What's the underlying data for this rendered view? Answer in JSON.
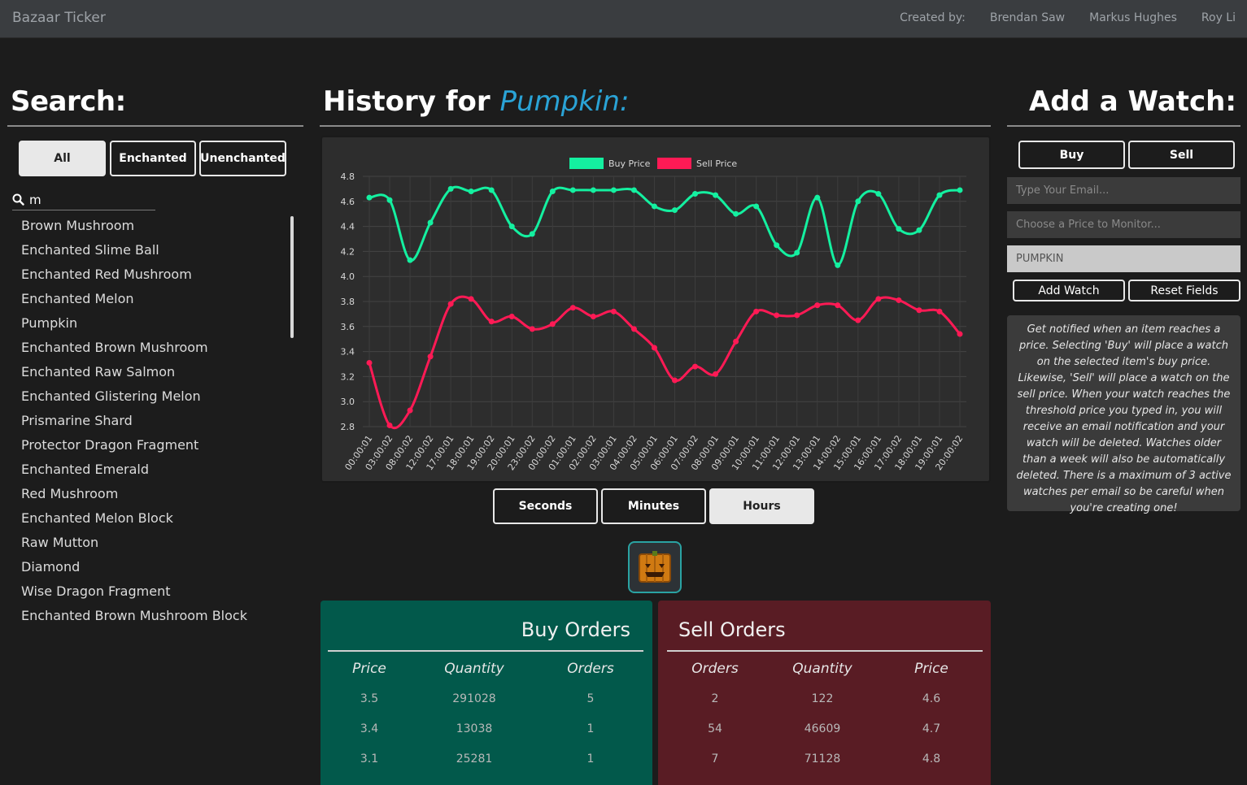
{
  "navbar": {
    "brand": "Bazaar Ticker",
    "created_by": "Created by:",
    "authors": [
      "Brendan Saw",
      "Markus Hughes",
      "Roy Li"
    ]
  },
  "search": {
    "title": "Search:",
    "filters": [
      "All",
      "Enchanted",
      "Unenchanted"
    ],
    "active_filter": "All",
    "query": "m",
    "items": [
      "Brown Mushroom",
      "Enchanted Slime Ball",
      "Enchanted Red Mushroom",
      "Enchanted Melon",
      "Pumpkin",
      "Enchanted Brown Mushroom",
      "Enchanted Raw Salmon",
      "Enchanted Glistering Melon",
      "Prismarine Shard",
      "Protector Dragon Fragment",
      "Enchanted Emerald",
      "Red Mushroom",
      "Enchanted Melon Block",
      "Raw Mutton",
      "Diamond",
      "Wise Dragon Fragment",
      "Enchanted Brown Mushroom Block"
    ]
  },
  "history": {
    "title_prefix": "History for",
    "item_name": "Pumpkin:",
    "time_buttons": [
      "Seconds",
      "Minutes",
      "Hours"
    ],
    "active_time": "Hours"
  },
  "chart_data": {
    "type": "line",
    "x": [
      "00:00:01",
      "03:00:02",
      "08:00:02",
      "12:00:02",
      "17:00:01",
      "18:00:01",
      "19:00:02",
      "20:00:01",
      "23:00:02",
      "00:00:02",
      "01:00:01",
      "02:00:02",
      "03:00:01",
      "04:00:02",
      "05:00:01",
      "06:00:01",
      "07:00:02",
      "08:00:01",
      "09:00:01",
      "10:00:01",
      "11:00:01",
      "12:00:01",
      "13:00:01",
      "14:00:02",
      "15:00:01",
      "16:00:01",
      "17:00:02",
      "18:00:01",
      "19:00:01",
      "20:00:02"
    ],
    "series": [
      {
        "name": "Buy Price",
        "color": "#14f0a0",
        "values": [
          4.63,
          4.61,
          4.13,
          4.43,
          4.7,
          4.68,
          4.69,
          4.4,
          4.34,
          4.68,
          4.69,
          4.69,
          4.69,
          4.69,
          4.56,
          4.53,
          4.66,
          4.65,
          4.5,
          4.56,
          4.25,
          4.19,
          4.63,
          4.09,
          4.6,
          4.66,
          4.38,
          4.37,
          4.65,
          4.69
        ]
      },
      {
        "name": "Sell Price",
        "color": "#ff1a55",
        "values": [
          3.31,
          2.81,
          2.93,
          3.36,
          3.78,
          3.82,
          3.64,
          3.68,
          3.58,
          3.62,
          3.75,
          3.68,
          3.72,
          3.58,
          3.43,
          3.17,
          3.28,
          3.22,
          3.48,
          3.72,
          3.69,
          3.69,
          3.77,
          3.77,
          3.65,
          3.82,
          3.81,
          3.73,
          3.72,
          3.54
        ]
      }
    ],
    "ylim": [
      2.8,
      4.8
    ],
    "yticks": [
      2.8,
      3.0,
      3.2,
      3.4,
      3.6,
      3.8,
      4.0,
      4.2,
      4.4,
      4.6,
      4.8
    ],
    "legend": "top-center",
    "grid": true
  },
  "buy_orders": {
    "title": "Buy Orders",
    "headers": [
      "Price",
      "Quantity",
      "Orders"
    ],
    "rows": [
      [
        "3.5",
        "291028",
        "5"
      ],
      [
        "3.4",
        "13038",
        "1"
      ],
      [
        "3.1",
        "25281",
        "1"
      ]
    ]
  },
  "sell_orders": {
    "title": "Sell Orders",
    "headers": [
      "Orders",
      "Quantity",
      "Price"
    ],
    "rows": [
      [
        "2",
        "122",
        "4.6"
      ],
      [
        "54",
        "46609",
        "4.7"
      ],
      [
        "7",
        "71128",
        "4.8"
      ]
    ]
  },
  "watch": {
    "title": "Add a Watch:",
    "buy_label": "Buy",
    "sell_label": "Sell",
    "email_placeholder": "Type Your Email...",
    "price_placeholder": "Choose a Price to Monitor...",
    "item_value": "PUMPKIN",
    "add_label": "Add Watch",
    "reset_label": "Reset Fields",
    "info": "Get notified when an item reaches a price. Selecting 'Buy' will place a watch on the selected item's buy price. Likewise, 'Sell' will place a watch on the sell price. When your watch reaches the threshold price you typed in, you will receive an email notification and your watch will be deleted. Watches older than a week will also be automatically deleted. There is a maximum of 3 active watches per email so be careful when you're creating one!"
  }
}
